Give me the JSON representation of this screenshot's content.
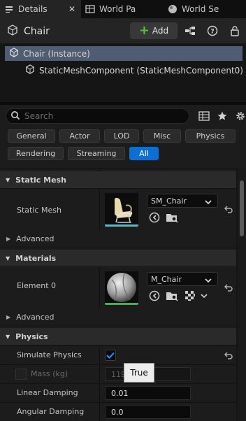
{
  "tabs": [
    {
      "label": "Details",
      "icon": "details-icon",
      "active": true
    },
    {
      "label": "World Pa",
      "icon": "map-icon",
      "active": false
    },
    {
      "label": "World Se",
      "icon": "globe-icon",
      "active": false
    }
  ],
  "header": {
    "title": "Chair",
    "add_label": "Add"
  },
  "tree": {
    "root": "Chair (Instance)",
    "child": "StaticMeshComponent (StaticMeshComponent0)"
  },
  "search": {
    "placeholder": "Search"
  },
  "filters": [
    "General",
    "Actor",
    "LOD",
    "Misc",
    "Physics",
    "Rendering",
    "Streaming",
    "All"
  ],
  "active_filter": "All",
  "sections": {
    "static_mesh": "Static Mesh",
    "materials": "Materials",
    "physics": "Physics"
  },
  "advanced_label": "Advanced",
  "static_mesh": {
    "label": "Static Mesh",
    "asset": "SM_Chair",
    "bar_color": "#3ec8d8"
  },
  "materials": {
    "label": "Element 0",
    "asset": "M_Chair",
    "bar_color": "#2fbf4a"
  },
  "physics": {
    "simulate_label": "Simulate Physics",
    "simulate_checked": true,
    "mass_label": "Mass (kg)",
    "mass_value": "119",
    "linear_label": "Linear Damping",
    "linear_value": "0.01",
    "angular_label": "Angular Damping",
    "angular_value": "0.0"
  },
  "tooltip": "True",
  "colors": {
    "accent": "#0e6fd3",
    "selection": "#4f5c72",
    "add_green": "#53c337"
  }
}
